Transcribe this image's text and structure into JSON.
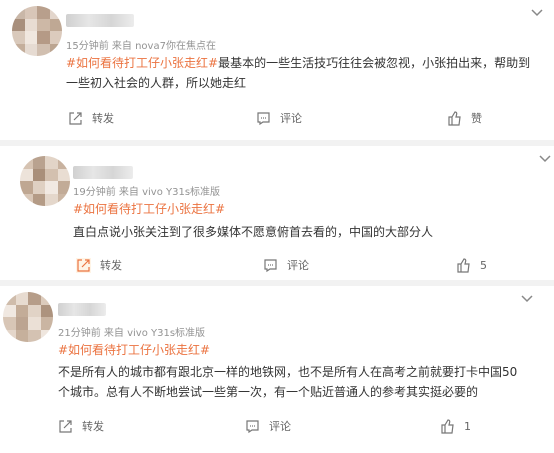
{
  "comments": [
    {
      "meta": "15分钟前 来自 nova7你在焦点在",
      "topic": "#如何看待打工仔小张走红#",
      "text": "最基本的一些生活技巧往往会被忽视，小张拍出来，帮助到一些初入社会的人群，所以她走红",
      "text_line2_break": "一些初入社会的人群，所以她走红",
      "actions": {
        "repost": "转发",
        "comment": "评论",
        "like": "赞"
      }
    },
    {
      "meta": "19分钟前 来自 vivo Y31s标准版",
      "topic": "#如何看待打工仔小张走红#",
      "text": "直白点说小张关注到了很多媒体不愿意俯首去看的，中国的大部分人",
      "actions": {
        "repost": "转发",
        "comment": "评论",
        "like": "5"
      }
    },
    {
      "meta": "21分钟前 来自 vivo Y31s标准版",
      "topic": "#如何看待打工仔小张走红#",
      "text_line1": "不是所有人的城市都有跟北京一样的地铁网，也不是所有人在高考之前就要打卡中国50",
      "text_line2": "个城市。总有人不断地尝试一些第一次，有一个贴近普通人的参考其实挺必要的",
      "actions": {
        "repost": "转发",
        "comment": "评论",
        "like": "1"
      }
    }
  ],
  "colors": {
    "topic": "#eb7340",
    "meta": "#939393",
    "text": "#333333"
  },
  "icons": [
    "chevron-down-icon",
    "repost-icon",
    "comment-icon",
    "like-icon"
  ]
}
